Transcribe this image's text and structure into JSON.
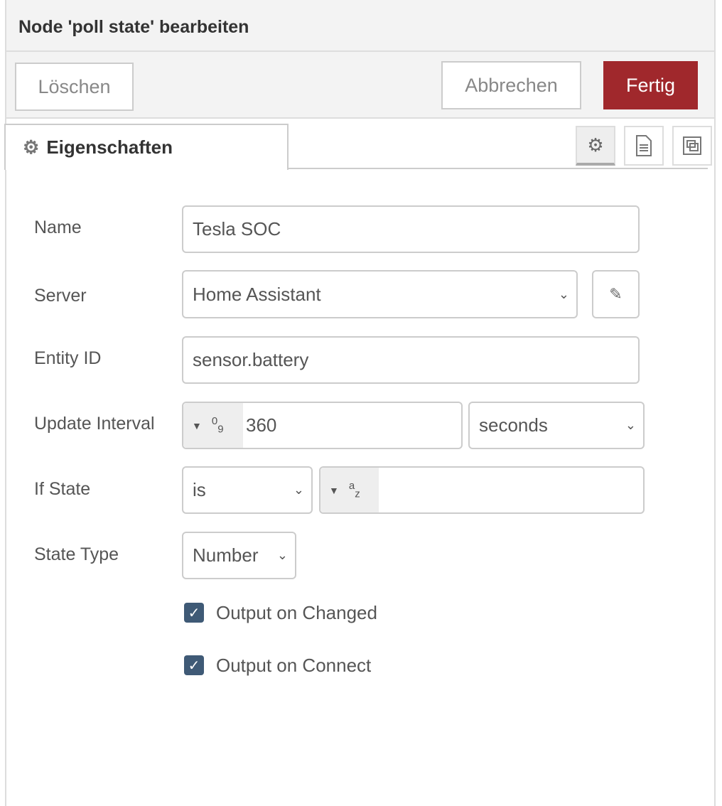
{
  "dialog": {
    "title": "Node 'poll state' bearbeiten"
  },
  "toolbar": {
    "delete": "Löschen",
    "cancel": "Abbrechen",
    "done": "Fertig"
  },
  "tabs": {
    "properties": "Eigenschaften"
  },
  "form": {
    "name_label": "Name",
    "name_value": "Tesla SOC",
    "server_label": "Server",
    "server_value": "Home Assistant",
    "entity_label": "Entity ID",
    "entity_value": "sensor.battery",
    "interval_label": "Update Interval",
    "interval_value": "360",
    "interval_type": "09",
    "interval_unit": "seconds",
    "ifstate_label": "If State",
    "ifstate_op": "is",
    "ifstate_type": "az",
    "ifstate_value": "",
    "statetype_label": "State Type",
    "statetype_value": "Number",
    "output_changed": "Output on Changed",
    "output_changed_checked": true,
    "output_connect": "Output on Connect",
    "output_connect_checked": true
  }
}
